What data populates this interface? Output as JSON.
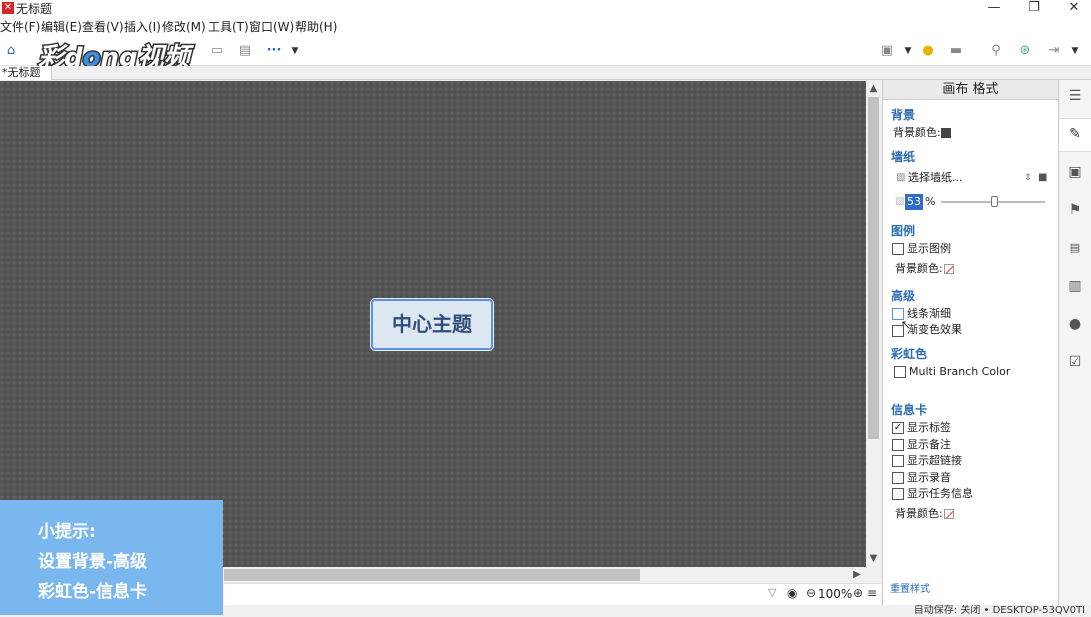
{
  "window": {
    "title": "无标题",
    "app_icon": "xmind-icon",
    "minimize": "—",
    "restore": "❐",
    "close": "✕"
  },
  "menu": [
    "文件(F)",
    "编辑(E)",
    "查看(V)",
    "插入(I)",
    "修改(M)",
    "工具(T)",
    "窗口(W)",
    "帮助(H)"
  ],
  "logo_text": "彩dong视频",
  "tab": {
    "label": "*无标题"
  },
  "canvas": {
    "central_topic": "中心主题",
    "background_color": "#555555"
  },
  "status": {
    "zoom": "100%",
    "autosave": "自动保存: 关闭",
    "user": "DESKTOP-53QV0TI"
  },
  "panel": {
    "title": "画布 格式",
    "background": {
      "heading": "背景",
      "color_label": "背景颜色:"
    },
    "wallpaper": {
      "heading": "墙纸",
      "select_label": "选择墙纸...",
      "opacity_value": "53",
      "opacity_unit": "%",
      "opacity_fraction": 0.53
    },
    "legend": {
      "heading": "图例",
      "show_label": "显示图例",
      "color_label": "背景颜色:"
    },
    "advanced": {
      "heading": "高级",
      "taper_label": "线条渐细",
      "gradient_label": "渐变色效果"
    },
    "rainbow": {
      "heading": "彩虹色",
      "multi_branch_label": "Multi Branch Color"
    },
    "info_card": {
      "heading": "信息卡",
      "items": [
        {
          "label": "显示标签",
          "checked": true
        },
        {
          "label": "显示备注",
          "checked": false
        },
        {
          "label": "显示超链接",
          "checked": false
        },
        {
          "label": "显示录音",
          "checked": false
        },
        {
          "label": "显示任务信息",
          "checked": false
        }
      ],
      "color_label": "背景颜色:"
    },
    "reset_label": "重置样式"
  },
  "tip": {
    "line1": "小提示:",
    "line2": "设置背景-高级",
    "line3": "彩虹色-信息卡"
  },
  "colors": {
    "accent": "#2a6db5",
    "tip_bg": "#7ab7ee",
    "topic_border": "#5b93d8"
  }
}
